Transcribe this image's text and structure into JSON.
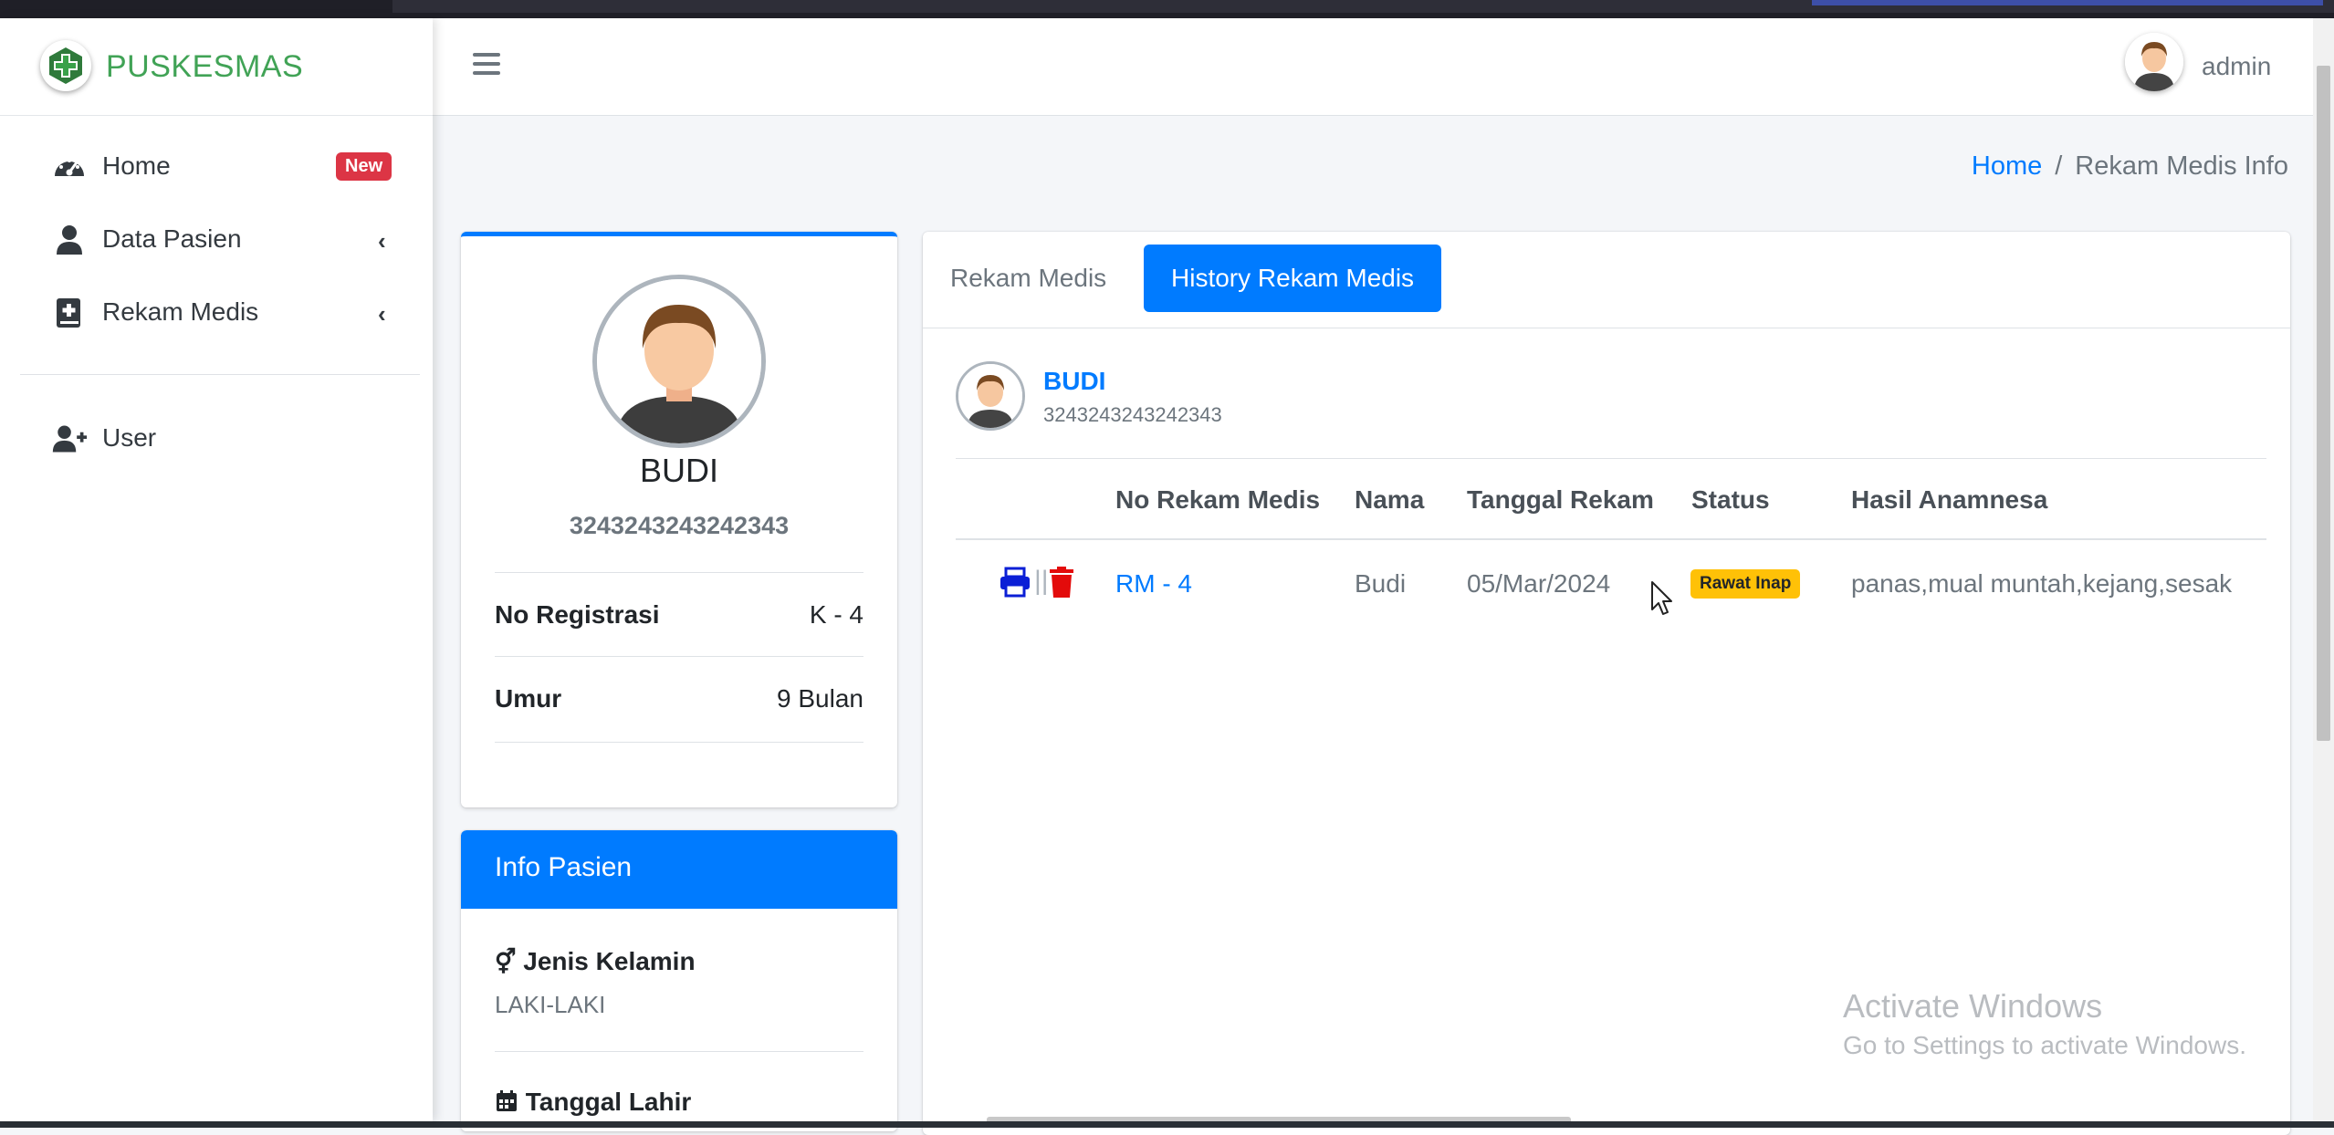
{
  "brand": {
    "name": "PUSKESMAS"
  },
  "sidebar": {
    "items": [
      {
        "label": "Home",
        "icon": "tachometer-icon",
        "badge": "New"
      },
      {
        "label": "Data Pasien",
        "icon": "user-icon",
        "chevron": "‹"
      },
      {
        "label": "Rekam Medis",
        "icon": "medical-book-icon",
        "chevron": "‹"
      },
      {
        "label": "User",
        "icon": "user-plus-icon"
      }
    ]
  },
  "header": {
    "user_name": "admin"
  },
  "breadcrumb": {
    "home": "Home",
    "separator": "/",
    "current": "Rekam Medis Info"
  },
  "profile": {
    "name": "BUDI",
    "nik": "3243243243242343",
    "rows": [
      {
        "key": "No Registrasi",
        "value": "K - 4"
      },
      {
        "key": "Umur",
        "value": "9 Bulan"
      }
    ]
  },
  "info": {
    "title": "Info Pasien",
    "fields": [
      {
        "label": "Jenis Kelamin",
        "value": "LAKI-LAKI",
        "icon": "venus-mars-icon"
      },
      {
        "label": "Tanggal Lahir",
        "icon": "calendar-icon"
      }
    ]
  },
  "tabs": [
    {
      "label": "Rekam Medis",
      "active": false
    },
    {
      "label": "History Rekam Medis",
      "active": true
    }
  ],
  "patient": {
    "name": "BUDI",
    "nik": "3243243243242343"
  },
  "table": {
    "headers": [
      "No Rekam Medis",
      "Nama",
      "Tanggal Rekam",
      "Status",
      "Hasil Anamnesa"
    ],
    "rows": [
      {
        "no_rekam": "RM - 4",
        "nama": "Budi",
        "tanggal": "05/Mar/2024",
        "status": "Rawat Inap",
        "hasil": "panas,mual muntah,kejang,sesak",
        "actions": {
          "separator": "||"
        }
      }
    ]
  },
  "watermark": {
    "line1": "Activate Windows",
    "line2": "Go to Settings to activate Windows."
  },
  "colors": {
    "primary": "#007bff",
    "brand": "#41a356",
    "danger": "#dc3545",
    "warning": "#ffc107"
  }
}
